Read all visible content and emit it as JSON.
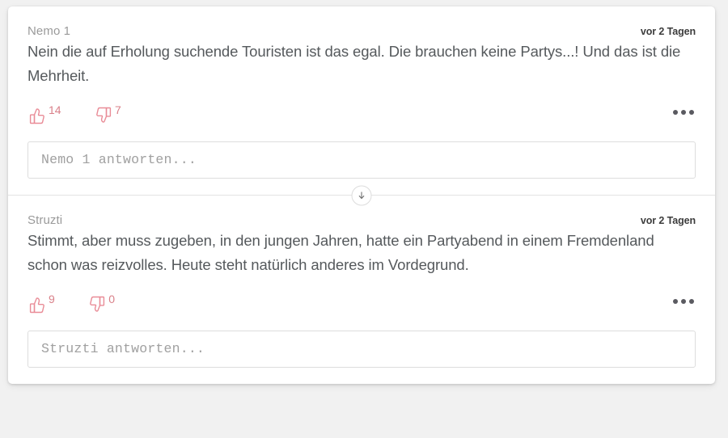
{
  "theme": {
    "page_background": "#f1f1f1",
    "card_background": "#ffffff",
    "vote_color": "#e98c97",
    "author_color": "#9a9a9a",
    "body_text_color": "#55595c",
    "timestamp_color": "#3c3c3c",
    "divider_color": "#e3e3e3",
    "more_dot_color": "#5a5a60"
  },
  "comments": [
    {
      "author": "Nemo 1",
      "timestamp": "vor 2 Tagen",
      "text": "Nein die auf Erholung suchende Touristen ist das egal. Die brauchen keine Partys...! Und das ist die Mehrheit.",
      "upvotes": "14",
      "downvotes": "7",
      "reply_placeholder": "Nemo 1 antworten...",
      "reply_value": "",
      "upvote_icon": "thumbs-up-icon",
      "downvote_icon": "thumbs-down-icon",
      "more_icon": "more-options-icon"
    },
    {
      "author": "Struzti",
      "timestamp": "vor 2 Tagen",
      "text": "Stimmt, aber muss zugeben, in den jungen Jahren, hatte ein Partyabend in einem Fremdenland schon was reizvolles. Heute steht natürlich anderes im Vordegrund.",
      "upvotes": "9",
      "downvotes": "0",
      "reply_placeholder": "Struzti antworten...",
      "reply_value": "",
      "upvote_icon": "thumbs-up-icon",
      "downvote_icon": "thumbs-down-icon",
      "more_icon": "more-options-icon"
    }
  ],
  "divider": {
    "expand_icon": "arrow-down-icon",
    "expand_label": ""
  }
}
